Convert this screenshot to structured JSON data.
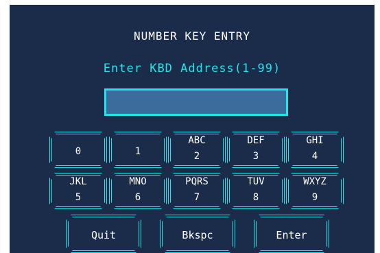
{
  "title": "NUMBER KEY ENTRY",
  "prompt": "Enter KBD Address(1-99)",
  "entry_value": "",
  "keys": [
    {
      "letters": "",
      "digit": "0"
    },
    {
      "letters": "",
      "digit": "1"
    },
    {
      "letters": "ABC",
      "digit": "2"
    },
    {
      "letters": "DEF",
      "digit": "3"
    },
    {
      "letters": "GHI",
      "digit": "4"
    },
    {
      "letters": "JKL",
      "digit": "5"
    },
    {
      "letters": "MNO",
      "digit": "6"
    },
    {
      "letters": "PQRS",
      "digit": "7"
    },
    {
      "letters": "TUV",
      "digit": "8"
    },
    {
      "letters": "WXYZ",
      "digit": "9"
    }
  ],
  "buttons": {
    "quit": "Quit",
    "backspace": "Bkspc",
    "enter": "Enter"
  },
  "colors": {
    "background": "#1b2c4a",
    "accent": "#20e6ee",
    "entry_fill": "#3c6c9c"
  }
}
